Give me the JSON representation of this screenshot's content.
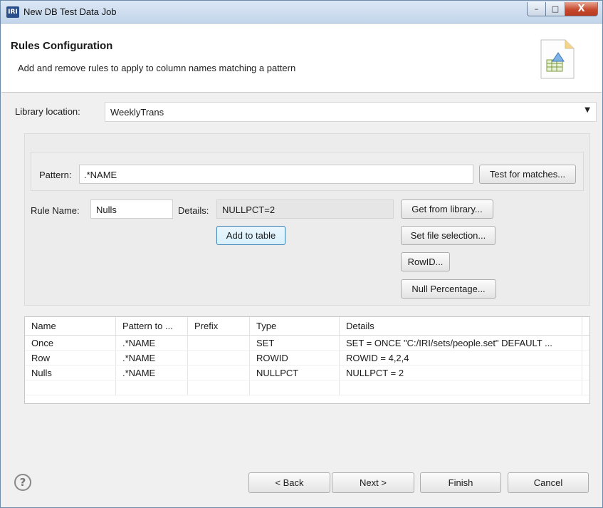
{
  "window": {
    "app_icon": "IRI",
    "title": "New DB Test Data Job",
    "controls": {
      "minimize": "–",
      "maximize": "□",
      "close": "X"
    }
  },
  "banner": {
    "title": "Rules Configuration",
    "description": "Add and remove rules to apply to column names matching a pattern",
    "icon": "wizard-table-icon"
  },
  "library": {
    "label": "Library location:",
    "value": "WeeklyTrans"
  },
  "pattern": {
    "label": "Pattern:",
    "value": ".*NAME",
    "test_button": "Test for matches..."
  },
  "rule": {
    "name_label": "Rule Name:",
    "name_value": "Nulls",
    "details_label": "Details:",
    "details_value": "NULLPCT=2",
    "add_button": "Add to table"
  },
  "side_buttons": {
    "get_from_library": "Get from library...",
    "set_file_selection": "Set file selection...",
    "rowid": "RowID...",
    "null_percentage": "Null Percentage..."
  },
  "table": {
    "columns": [
      "Name",
      "Pattern to ...",
      "Prefix",
      "Type",
      "Details"
    ],
    "rows": [
      [
        "Once",
        ".*NAME",
        "",
        "SET",
        "SET = ONCE \"C:/IRI/sets/people.set\" DEFAULT ..."
      ],
      [
        "Row",
        ".*NAME",
        "",
        "ROWID",
        "ROWID = 4,2,4"
      ],
      [
        "Nulls",
        ".*NAME",
        "",
        "NULLPCT",
        "NULLPCT = 2"
      ]
    ]
  },
  "footer": {
    "help": "?",
    "back": "< Back",
    "next": "Next >",
    "finish": "Finish",
    "cancel": "Cancel"
  }
}
